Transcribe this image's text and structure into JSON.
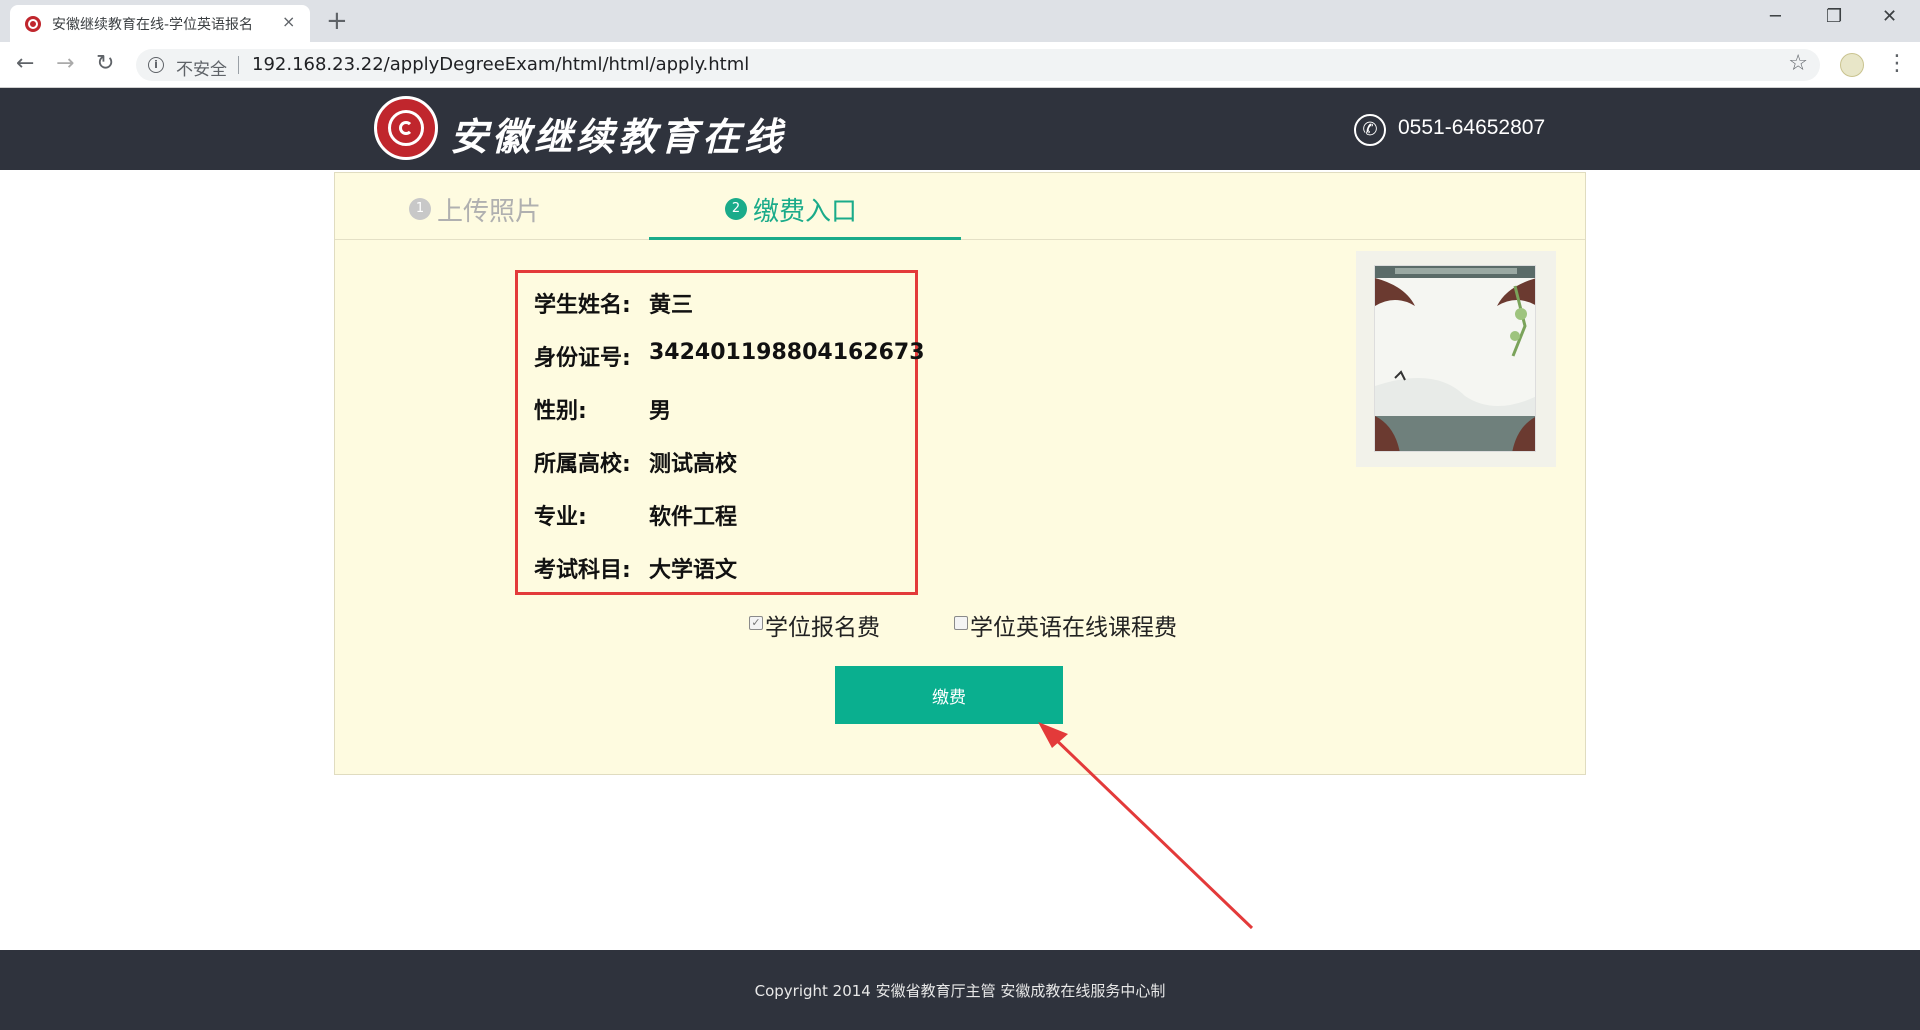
{
  "browser": {
    "tab_title": "安徽继续教育在线-学位英语报名",
    "tab_close": "×",
    "new_tab": "+",
    "security_label": "不安全",
    "url": "192.168.23.22/applyDegreeExam/html/html/apply.html",
    "window_minimize": "─",
    "window_restore": "❐",
    "window_close": "✕",
    "back": "←",
    "forward": "→",
    "reload": "↻",
    "bookmark": "☆",
    "menu": "⋮"
  },
  "header": {
    "logo_text": "安徽继续教育在线",
    "phone": "0551-64652807",
    "phone_icon": "phone-icon"
  },
  "steps": [
    {
      "num": "1",
      "label": "上传照片",
      "active": false
    },
    {
      "num": "2",
      "label": "缴费入口",
      "active": true
    }
  ],
  "student": [
    {
      "label": "学生姓名:",
      "value": "黄三"
    },
    {
      "label": "身份证号:",
      "value": "342401198804162673"
    },
    {
      "label": "性别:",
      "value": "男"
    },
    {
      "label": "所属高校:",
      "value": "测试高校"
    },
    {
      "label": "专业:",
      "value": "软件工程"
    },
    {
      "label": "考试科目:",
      "value": "大学语文"
    }
  ],
  "options": [
    {
      "label": "学位报名费",
      "checked": true
    },
    {
      "label": "学位英语在线课程费",
      "checked": false
    }
  ],
  "pay_button": "缴费",
  "footer": {
    "copyright": "Copyright 2014 安徽省教育厅主管 安徽成教在线服务中心制"
  },
  "colors": {
    "accent": "#1aab8a",
    "header_bg": "#2f333d",
    "panel_bg": "#fefbe0",
    "highlight_red": "#e33a3a"
  }
}
